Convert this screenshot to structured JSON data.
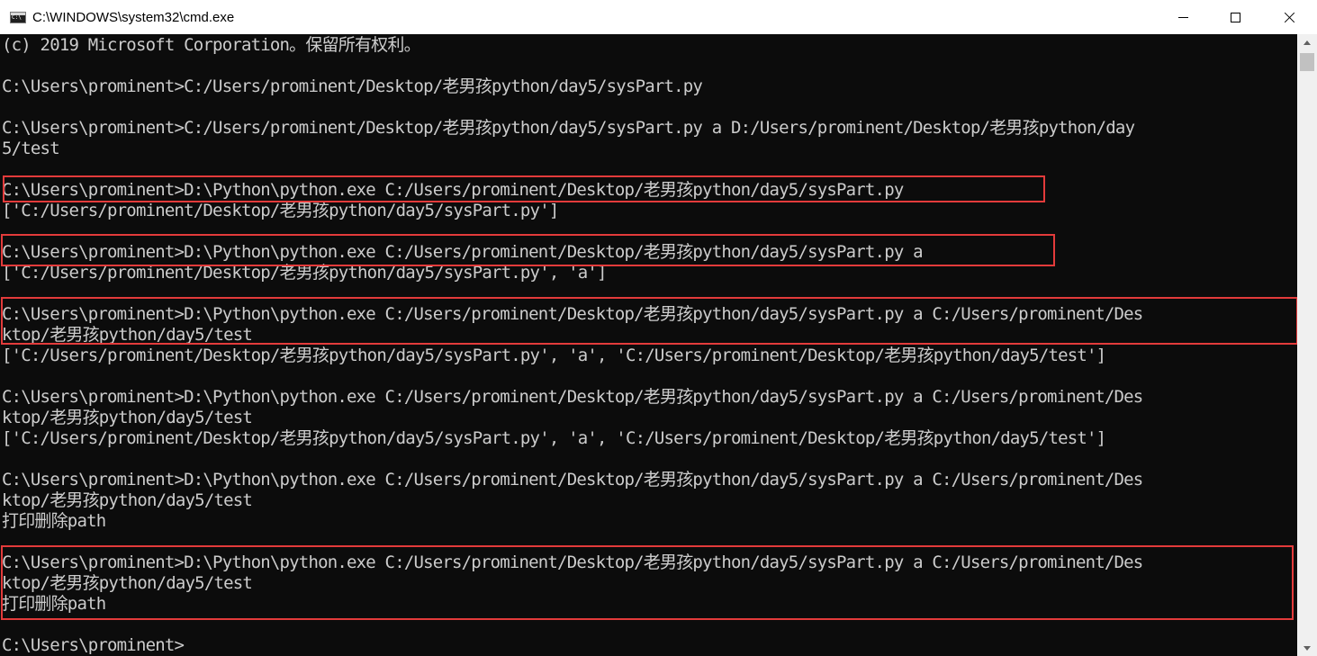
{
  "window": {
    "title": "C:\\WINDOWS\\system32\\cmd.exe",
    "icon": "cmd-icon",
    "controls": {
      "minimize_icon": "minimize-icon",
      "maximize_icon": "maximize-icon",
      "close_icon": "close-icon"
    }
  },
  "colors": {
    "background": "#0c0c0c",
    "text": "#cccccc",
    "highlight_border": "#e33b3b"
  },
  "console": {
    "lines": [
      "(c) 2019 Microsoft Corporation。保留所有权利。",
      "",
      "C:\\Users\\prominent>C:/Users/prominent/Desktop/老男孩python/day5/sysPart.py",
      "",
      "C:\\Users\\prominent>C:/Users/prominent/Desktop/老男孩python/day5/sysPart.py a D:/Users/prominent/Desktop/老男孩python/day",
      "5/test",
      "",
      "C:\\Users\\prominent>D:\\Python\\python.exe C:/Users/prominent/Desktop/老男孩python/day5/sysPart.py",
      "['C:/Users/prominent/Desktop/老男孩python/day5/sysPart.py']",
      "",
      "C:\\Users\\prominent>D:\\Python\\python.exe C:/Users/prominent/Desktop/老男孩python/day5/sysPart.py a",
      "['C:/Users/prominent/Desktop/老男孩python/day5/sysPart.py', 'a']",
      "",
      "C:\\Users\\prominent>D:\\Python\\python.exe C:/Users/prominent/Desktop/老男孩python/day5/sysPart.py a C:/Users/prominent/Des",
      "ktop/老男孩python/day5/test",
      "['C:/Users/prominent/Desktop/老男孩python/day5/sysPart.py', 'a', 'C:/Users/prominent/Desktop/老男孩python/day5/test']",
      "",
      "C:\\Users\\prominent>D:\\Python\\python.exe C:/Users/prominent/Desktop/老男孩python/day5/sysPart.py a C:/Users/prominent/Des",
      "ktop/老男孩python/day5/test",
      "['C:/Users/prominent/Desktop/老男孩python/day5/sysPart.py', 'a', 'C:/Users/prominent/Desktop/老男孩python/day5/test']",
      "",
      "C:\\Users\\prominent>D:\\Python\\python.exe C:/Users/prominent/Desktop/老男孩python/day5/sysPart.py a C:/Users/prominent/Des",
      "ktop/老男孩python/day5/test",
      "打印删除path",
      "",
      "C:\\Users\\prominent>D:\\Python\\python.exe C:/Users/prominent/Desktop/老男孩python/day5/sysPart.py a C:/Users/prominent/Des",
      "ktop/老男孩python/day5/test",
      "打印删除path",
      "",
      "C:\\Users\\prominent>"
    ]
  },
  "scrollbar": {
    "up_icon": "scroll-up-arrow-icon",
    "down_icon": "scroll-down-arrow-icon"
  }
}
